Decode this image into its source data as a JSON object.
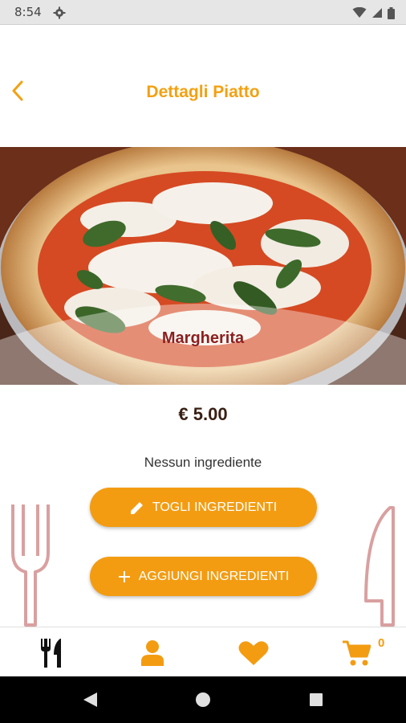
{
  "status_bar": {
    "time": "8:54",
    "icons": [
      "gear-icon",
      "wifi-icon",
      "signal-icon",
      "battery-icon"
    ]
  },
  "header": {
    "title": "Dettagli Piatto",
    "back_icon": "chevron-left-icon"
  },
  "dish": {
    "name": "Margherita",
    "price": "€ 5.00",
    "ingredients_note": "Nessun ingrediente"
  },
  "actions": {
    "remove_label": "TOGLI INGREDIENTI",
    "remove_icon": "pencil-icon",
    "add_label": "AGGIUNGI INGREDIENTI",
    "add_icon": "plus-icon"
  },
  "bottom_nav": {
    "items": [
      "menu-icon",
      "user-icon",
      "heart-icon",
      "cart-icon"
    ],
    "cart_count": "0"
  },
  "system_nav": [
    "back-triangle-icon",
    "home-circle-icon",
    "recents-square-icon"
  ],
  "colors": {
    "accent": "#f39c12",
    "title": "#f2a112",
    "dish_name": "#8b1f1f",
    "decor": "#d9a0a0"
  }
}
